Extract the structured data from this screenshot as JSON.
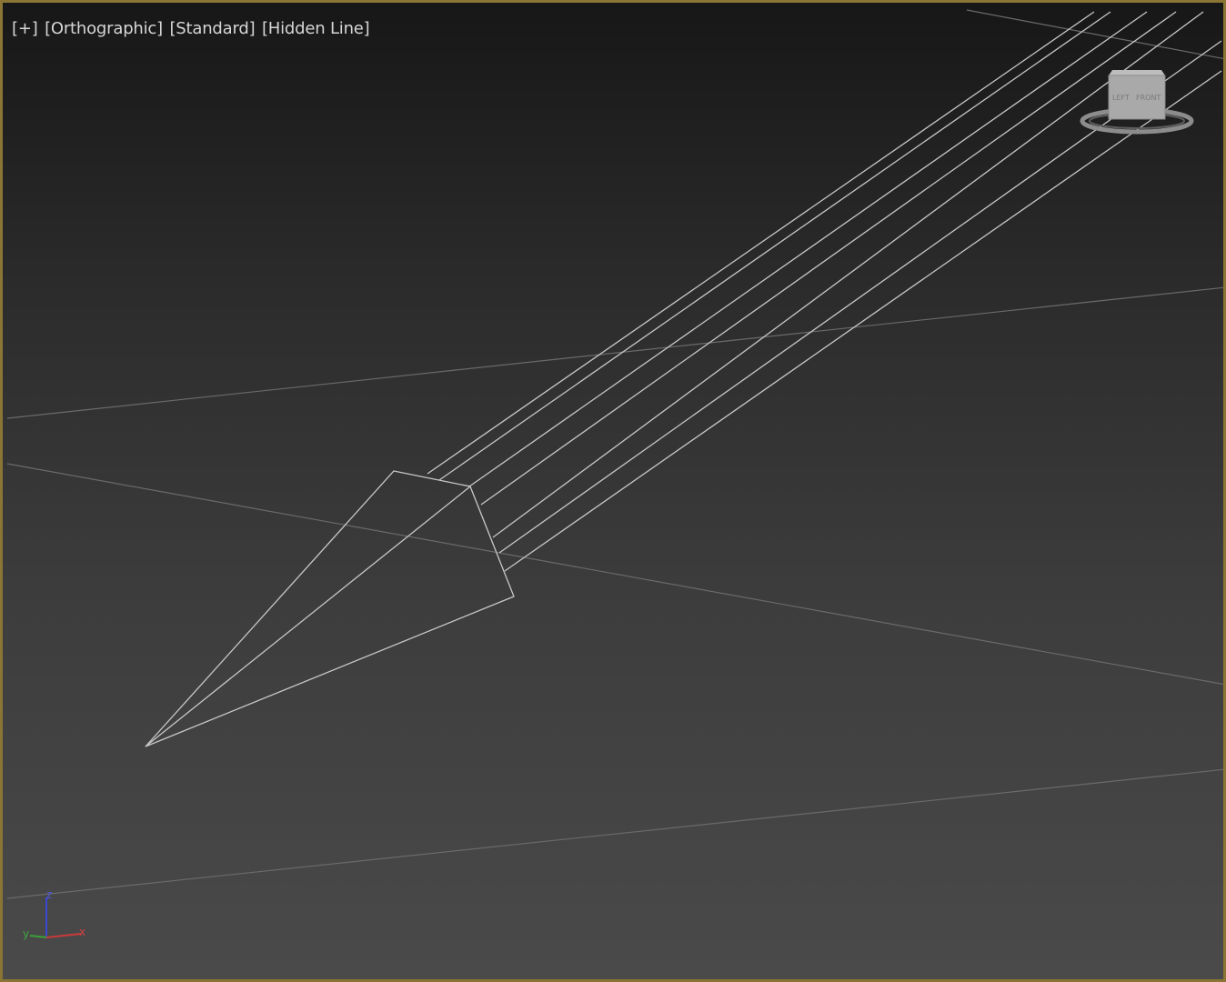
{
  "viewport": {
    "labels": [
      "[+]",
      "[Orthographic]",
      "[Standard]",
      "[Hidden Line]"
    ],
    "border_color": "#8a7535",
    "wire_color": "#c8c8c8"
  },
  "viewcube": {
    "face_label": "FRONT",
    "side_label": "LEFT"
  },
  "axis": {
    "x_label": "x",
    "y_label": "y",
    "z_label": "z",
    "x_color": "#c83a3a",
    "y_color": "#3aa03a",
    "z_color": "#3a4ad0"
  }
}
